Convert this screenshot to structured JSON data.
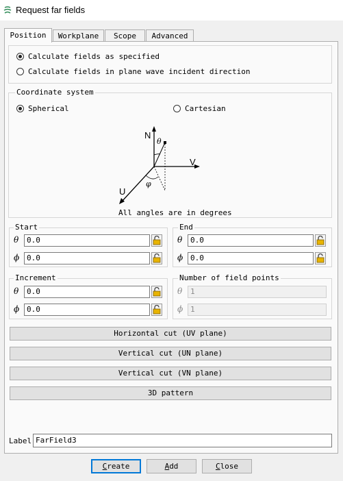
{
  "window": {
    "title": "Request far fields",
    "icon": "far-field-icon"
  },
  "tabs": [
    {
      "label": "Position",
      "active": true
    },
    {
      "label": "Workplane",
      "active": false
    },
    {
      "label": "Scope",
      "active": false
    },
    {
      "label": "Advanced",
      "active": false
    }
  ],
  "calc_mode": {
    "options": [
      {
        "label": "Calculate fields as specified",
        "selected": true
      },
      {
        "label": "Calculate fields in plane wave incident direction",
        "selected": false
      }
    ]
  },
  "coordinate_system": {
    "title": "Coordinate system",
    "options": [
      {
        "label": "Spherical",
        "selected": true
      },
      {
        "label": "Cartesian",
        "selected": false
      }
    ],
    "diagram": {
      "axis_n": "N",
      "axis_v": "V",
      "axis_u": "U",
      "theta": "θ",
      "phi": "φ",
      "caption": "All angles are in degrees"
    }
  },
  "start": {
    "title": "Start",
    "theta_symbol": "θ",
    "phi_symbol": "ϕ",
    "theta": "0.0",
    "phi": "0.0"
  },
  "end": {
    "title": "End",
    "theta_symbol": "θ",
    "phi_symbol": "ϕ",
    "theta": "0.0",
    "phi": "0.0"
  },
  "increment": {
    "title": "Increment",
    "theta_symbol": "θ",
    "phi_symbol": "ϕ",
    "theta": "0.0",
    "phi": "0.0"
  },
  "num_points": {
    "title": "Number of field points",
    "theta_symbol": "θ",
    "phi_symbol": "ϕ",
    "theta": "1",
    "phi": "1"
  },
  "cut_buttons": {
    "horizontal": "Horizontal cut (UV plane)",
    "vertical_un": "Vertical cut (UN plane)",
    "vertical_vn": "Vertical cut (VN plane)",
    "pattern_3d": "3D pattern"
  },
  "label_field": {
    "label": "Label",
    "value": "FarField3"
  },
  "footer": {
    "create_mnemonic": "C",
    "create_rest": "reate",
    "add_mnemonic": "A",
    "add_rest": "dd",
    "close_mnemonic": "C",
    "close_rest": "lose"
  },
  "colors": {
    "accent": "#0078d7",
    "lock": "#e8b400"
  }
}
